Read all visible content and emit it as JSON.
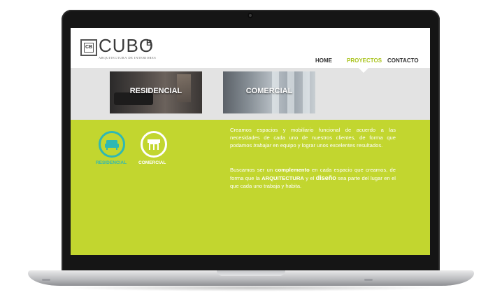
{
  "brand": {
    "logo_mark": "CB",
    "name": "CUBO",
    "superscript": "B",
    "tagline": "ARQUITECTURA DE INTERIORES"
  },
  "nav": {
    "items": [
      {
        "label": "HOME",
        "active": false
      },
      {
        "label": "PROYECTOS",
        "active": true
      },
      {
        "label": "CONTACTO",
        "active": false
      }
    ]
  },
  "projects": {
    "thumbs": [
      {
        "label": "RESIDENCIAL"
      },
      {
        "label": "COMERCIAL"
      }
    ]
  },
  "categories": [
    {
      "label": "RESIDENCIAL",
      "icon": "sofa-icon"
    },
    {
      "label": "COMERCIAL",
      "icon": "storefront-icon"
    }
  ],
  "content": {
    "p1_a": "Creamos espacios y mobiliario funcional de acuerdo a las necesidades de cada uno de nuestros clientes, de forma que podamos ",
    "p1_em": "trabajar",
    "p1_b": " en equipo y lograr unos excelentes resultados.",
    "p2_a": "Buscamos ser un ",
    "p2_bold1": "complemento",
    "p2_b": " en cada espacio que creamos, de forma que la ",
    "p2_bold2": "ARQUITECTURA",
    "p2_c": " y el ",
    "p2_bold3": "diseño",
    "p2_d": " sea parte del lugar en el que cada uno trabaja y habita."
  },
  "colors": {
    "accent_green": "#c2d62f",
    "nav_active": "#a9c31c",
    "teal": "#2fb8b4"
  }
}
